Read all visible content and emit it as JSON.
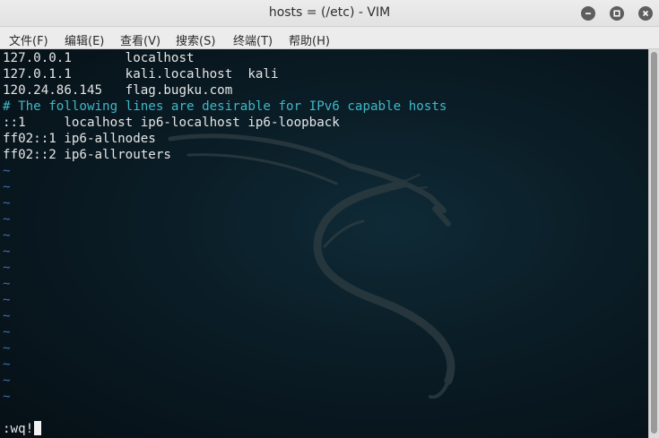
{
  "window": {
    "title": "hosts = (/etc) - VIM"
  },
  "menu": {
    "items": [
      "文件(F)",
      "编辑(E)",
      "查看(V)",
      "搜索(S)",
      "终端(T)",
      "帮助(H)"
    ]
  },
  "editor": {
    "lines": [
      "127.0.0.1       localhost",
      "127.0.1.1       kali.localhost  kali",
      "120.24.86.145   flag.bugku.com",
      "# The following lines are desirable for IPv6 capable hosts",
      "::1     localhost ip6-localhost ip6-loopback",
      "ff02::1 ip6-allnodes",
      "ff02::2 ip6-allrouters"
    ],
    "comment_line_index": 3,
    "tilde_char": "~",
    "tilde_count": 15,
    "command": ":wq!"
  },
  "colors": {
    "text": "#e6e6e6",
    "comment": "#3fb8c8",
    "tilde": "#3f6fb5",
    "background": "#0a1c25"
  },
  "icons": {
    "minimize": "minimize-icon",
    "maximize": "maximize-icon",
    "close": "close-icon",
    "wallpaper": "kali-dragon-logo"
  }
}
